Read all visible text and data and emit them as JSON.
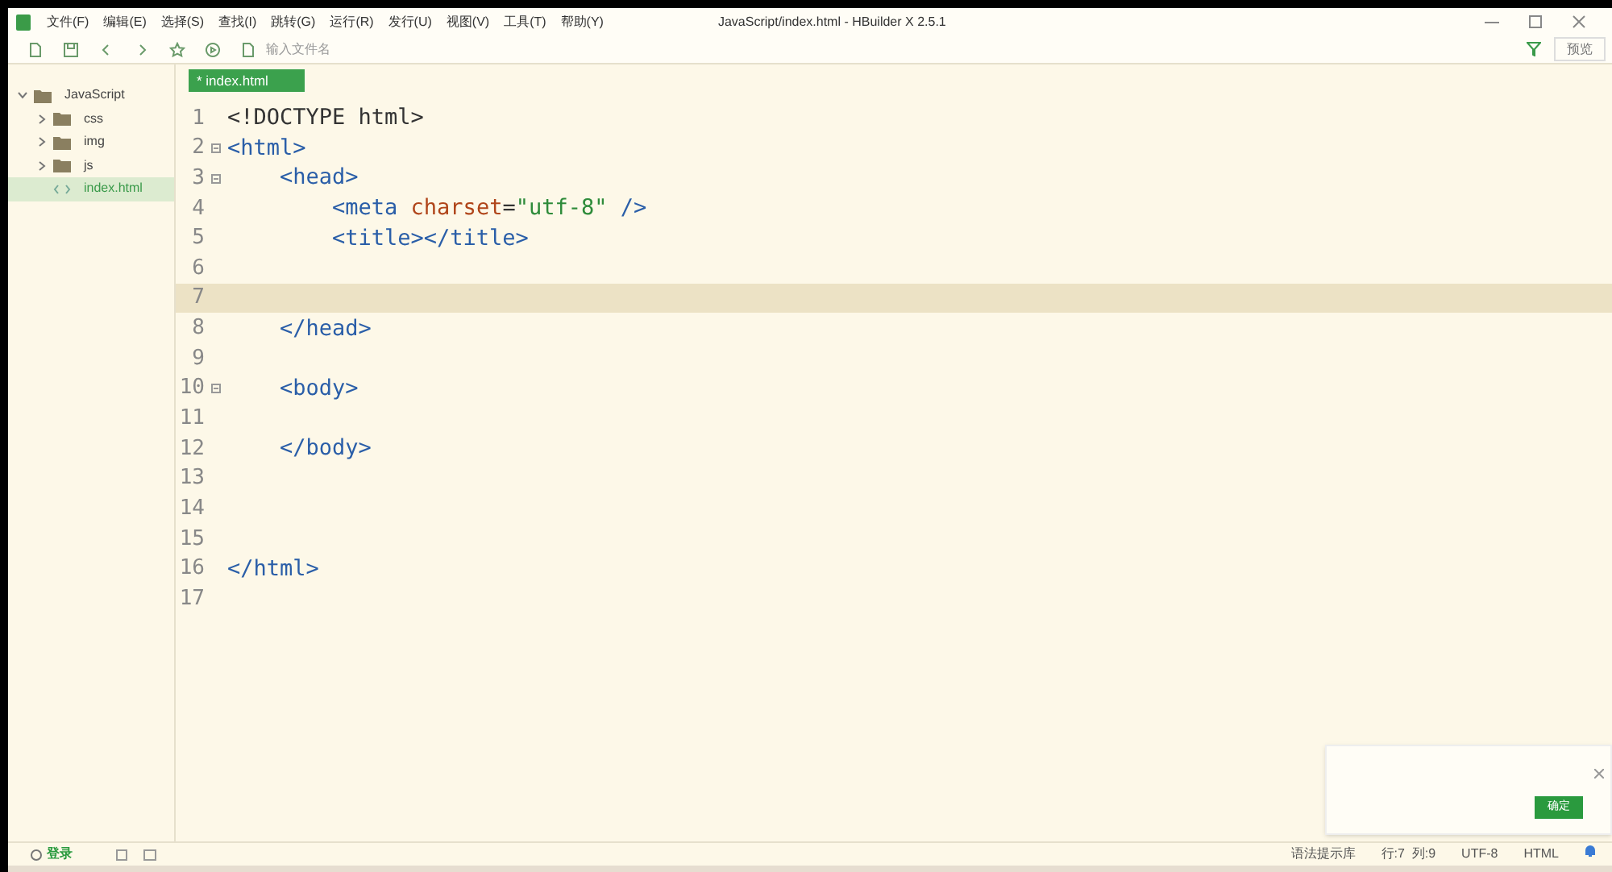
{
  "window": {
    "title": "JavaScript/index.html - HBuilder X 2.5.1"
  },
  "menu": [
    "文件(F)",
    "编辑(E)",
    "选择(S)",
    "查找(I)",
    "跳转(G)",
    "运行(R)",
    "发行(U)",
    "视图(V)",
    "工具(T)",
    "帮助(Y)"
  ],
  "toolbar": {
    "search": {
      "placeholder": "输入文件名"
    },
    "preview_button": "预览"
  },
  "sidebar": {
    "items": [
      {
        "label": "JavaScript",
        "kind": "folder",
        "expanded": true,
        "selected": false,
        "children": [
          {
            "label": "css",
            "kind": "folder",
            "expanded": false,
            "selected": false
          },
          {
            "label": "img",
            "kind": "folder",
            "expanded": false,
            "selected": false
          },
          {
            "label": "js",
            "kind": "folder",
            "expanded": false,
            "selected": false
          },
          {
            "label": "index.html",
            "kind": "file",
            "selected": true
          }
        ]
      }
    ]
  },
  "tabs": [
    {
      "label": "* index.html",
      "selected": true
    }
  ],
  "editor": {
    "lines": [
      {
        "number": "1",
        "fold": false,
        "current": false,
        "tokens": [
          {
            "kind": "text",
            "text": "<!DOCTYPE html>"
          }
        ]
      },
      {
        "number": "2",
        "fold": true,
        "current": false,
        "tokens": [
          {
            "kind": "tag",
            "text": "<html>"
          }
        ]
      },
      {
        "number": "3",
        "fold": true,
        "current": false,
        "tokens": [
          {
            "kind": "tag",
            "text": "    <head>"
          }
        ]
      },
      {
        "number": "4",
        "fold": false,
        "current": false,
        "tokens": [
          {
            "kind": "tag",
            "text": "        <meta"
          },
          {
            "kind": "attr",
            "text": " charset"
          },
          {
            "kind": "text",
            "text": "="
          },
          {
            "kind": "string",
            "text": "\"utf-8\""
          },
          {
            "kind": "tag",
            "text": " />"
          }
        ]
      },
      {
        "number": "5",
        "fold": false,
        "current": false,
        "tokens": [
          {
            "kind": "tag",
            "text": "        <title></title>"
          }
        ]
      },
      {
        "number": "6",
        "fold": false,
        "current": false
      },
      {
        "number": "7",
        "fold": false,
        "current": true
      },
      {
        "number": "8",
        "fold": false,
        "current": false,
        "tokens": [
          {
            "kind": "tag",
            "text": "    </head>"
          }
        ]
      },
      {
        "number": "9",
        "fold": false,
        "current": false
      },
      {
        "number": "10",
        "fold": true,
        "current": false,
        "tokens": [
          {
            "kind": "tag",
            "text": "    <body>"
          }
        ]
      },
      {
        "number": "11",
        "fold": false,
        "current": false
      },
      {
        "number": "12",
        "fold": false,
        "current": false,
        "tokens": [
          {
            "kind": "tag",
            "text": "    </body>"
          }
        ]
      },
      {
        "number": "13",
        "fold": false,
        "current": false
      },
      {
        "number": "14",
        "fold": false,
        "current": false
      },
      {
        "number": "15",
        "fold": false,
        "current": false
      },
      {
        "number": "16",
        "fold": false,
        "current": false,
        "tokens": [
          {
            "kind": "tag",
            "text": "</html>"
          }
        ]
      },
      {
        "number": "17",
        "fold": false,
        "current": false
      }
    ]
  },
  "notification": {
    "button": "确定"
  },
  "status_bar": {
    "login": "登录",
    "items": [
      "语法提示库",
      "行:7  列:9",
      "UTF-8",
      "HTML"
    ]
  }
}
